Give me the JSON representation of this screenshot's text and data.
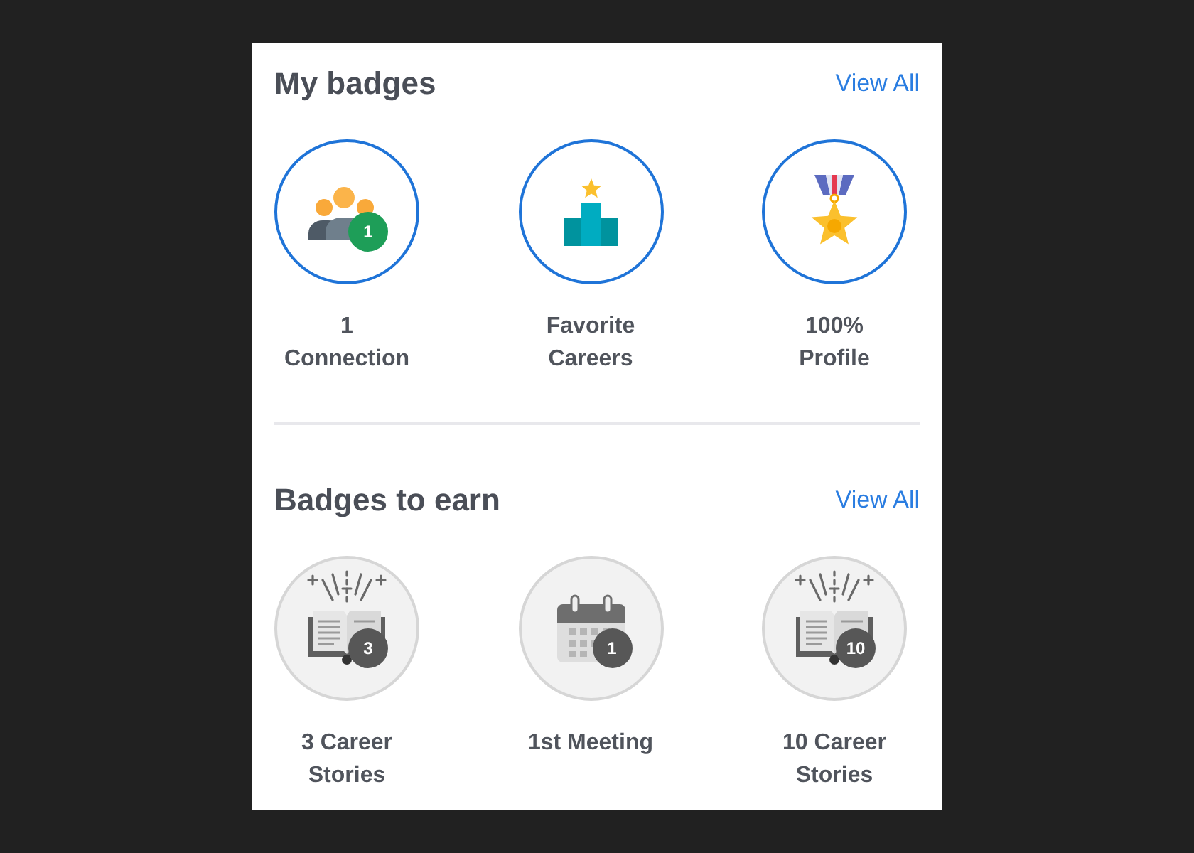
{
  "sections": [
    {
      "title": "My badges",
      "link": "View All",
      "badges": [
        {
          "kind": "people",
          "earned": true,
          "count": "1",
          "label": "1 Connection"
        },
        {
          "kind": "podium",
          "earned": true,
          "label": "Favorite Careers"
        },
        {
          "kind": "medal",
          "earned": true,
          "label": "100% Profile"
        }
      ]
    },
    {
      "title": "Badges to earn",
      "link": "View All",
      "badges": [
        {
          "kind": "book",
          "earned": false,
          "count": "3",
          "label": "3 Career Stories"
        },
        {
          "kind": "calendar",
          "earned": false,
          "count": "1",
          "label": "1st Meeting"
        },
        {
          "kind": "book",
          "earned": false,
          "count": "10",
          "label": "10 Career Stories"
        }
      ]
    }
  ]
}
